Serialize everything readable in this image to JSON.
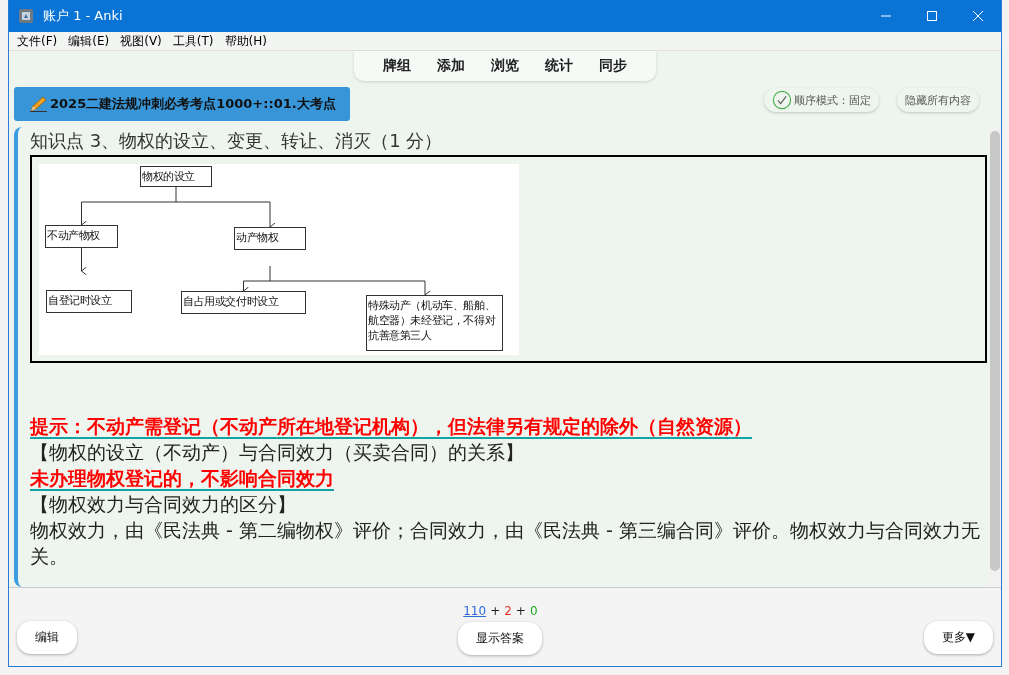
{
  "window": {
    "title": "账户 1 - Anki"
  },
  "menu": [
    {
      "label": "文件(F)"
    },
    {
      "label": "编辑(E)"
    },
    {
      "label": "视图(V)"
    },
    {
      "label": "工具(T)"
    },
    {
      "label": "帮助(H)"
    }
  ],
  "toolbar": [
    {
      "label": "牌组"
    },
    {
      "label": "添加"
    },
    {
      "label": "浏览"
    },
    {
      "label": "统计"
    },
    {
      "label": "同步"
    }
  ],
  "deck_button": {
    "label": "2025二建法规冲刺必考考点1000+::01.大考点"
  },
  "order_mode": {
    "label": "顺序模式：固定",
    "checked": true
  },
  "hide_button": {
    "label": "隐藏所有内容"
  },
  "card": {
    "title": "知识点 3、物权的设立、变更、转让、消灭（1 分）",
    "diagram": {
      "nodes": [
        {
          "text": "物权的设立"
        },
        {
          "text": "不动产物权"
        },
        {
          "text": "动产物权"
        },
        {
          "text": "自登记时设立"
        },
        {
          "text": "自占用或交付时设立"
        },
        {
          "text": "特殊动产（机动车、船舶、航空器）未经登记，不得对抗善意第三人"
        }
      ]
    },
    "lines": [
      {
        "kind": "highlight",
        "text": "提示：不动产需登记（不动产所在地登记机构），但法律另有规定的除外（自然资源）"
      },
      {
        "kind": "plain",
        "text": "【物权的设立（不动产）与合同效力（买卖合同）的关系】"
      },
      {
        "kind": "highlight",
        "text": "未办理物权登记的，不影响合同效力"
      },
      {
        "kind": "plain",
        "text": "【物权效力与合同效力的区分】"
      },
      {
        "kind": "plain",
        "text": "物权效力，由《民法典 - 第二编物权》评价；合同效力，由《民法典 - 第三编合同》评价。物权效力与合同效力无关。"
      }
    ]
  },
  "counts": {
    "new": "110",
    "plus_1": "+",
    "learning": "2",
    "plus_2": "+",
    "review": "0"
  },
  "bottom": {
    "edit": "编辑",
    "show_answer": "显示答案",
    "more": "更多▼"
  }
}
